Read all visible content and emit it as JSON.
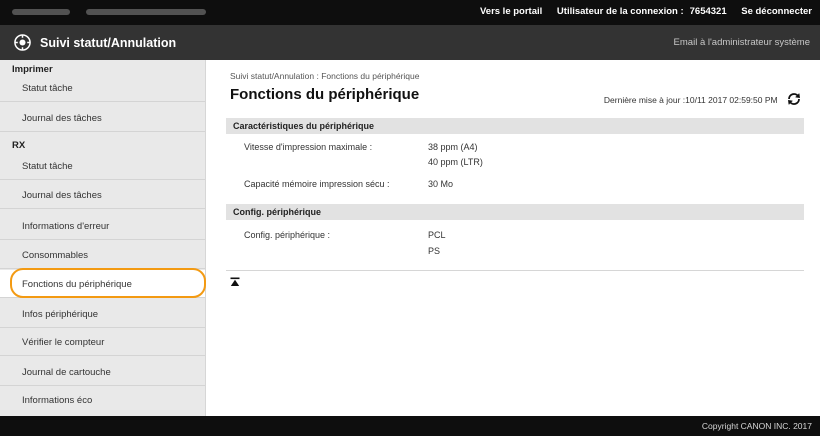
{
  "topbar": {
    "portal_link": "Vers le portail",
    "login_user_label": "Utilisateur de la connexion :",
    "login_user_id": "7654321",
    "logout_link": "Se déconnecter"
  },
  "header": {
    "title": "Suivi statut/Annulation",
    "email_admin": "Email à l'administrateur système"
  },
  "sidebar": {
    "sections": [
      {
        "heading": "Imprimer",
        "items": [
          "Statut tâche",
          "Journal des tâches"
        ]
      },
      {
        "heading": "RX",
        "items": [
          "Statut tâche",
          "Journal des tâches"
        ]
      }
    ],
    "items": [
      "Informations d'erreur",
      "Consommables",
      "Fonctions du périphérique",
      "Infos périphérique",
      "Vérifier le compteur",
      "Journal de cartouche",
      "Informations éco"
    ],
    "selected": "Fonctions du périphérique"
  },
  "main": {
    "breadcrumb": "Suivi statut/Annulation : Fonctions du périphérique",
    "title": "Fonctions du périphérique",
    "last_update": "Dernière mise à jour :10/11 2017 02:59:50 PM",
    "characteristics": {
      "heading": "Caractéristiques du périphérique",
      "rows": [
        {
          "label": "Vitesse d'impression maximale :",
          "values": [
            "38 ppm (A4)",
            "40 ppm (LTR)"
          ]
        },
        {
          "label": "Capacité mémoire impression sécu :",
          "values": [
            "30 Mo"
          ]
        }
      ]
    },
    "config": {
      "heading": "Config. périphérique",
      "rows": [
        {
          "label": "Config. périphérique :",
          "values": [
            "PCL",
            "PS"
          ]
        }
      ]
    }
  },
  "footer": {
    "copyright": "Copyright CANON INC. 2017"
  },
  "colors": {
    "highlight_ring": "#f39a12",
    "title_bar": "#333333",
    "top_bar": "#0e0e0e",
    "sidebar_bg": "#e9e9e9"
  }
}
